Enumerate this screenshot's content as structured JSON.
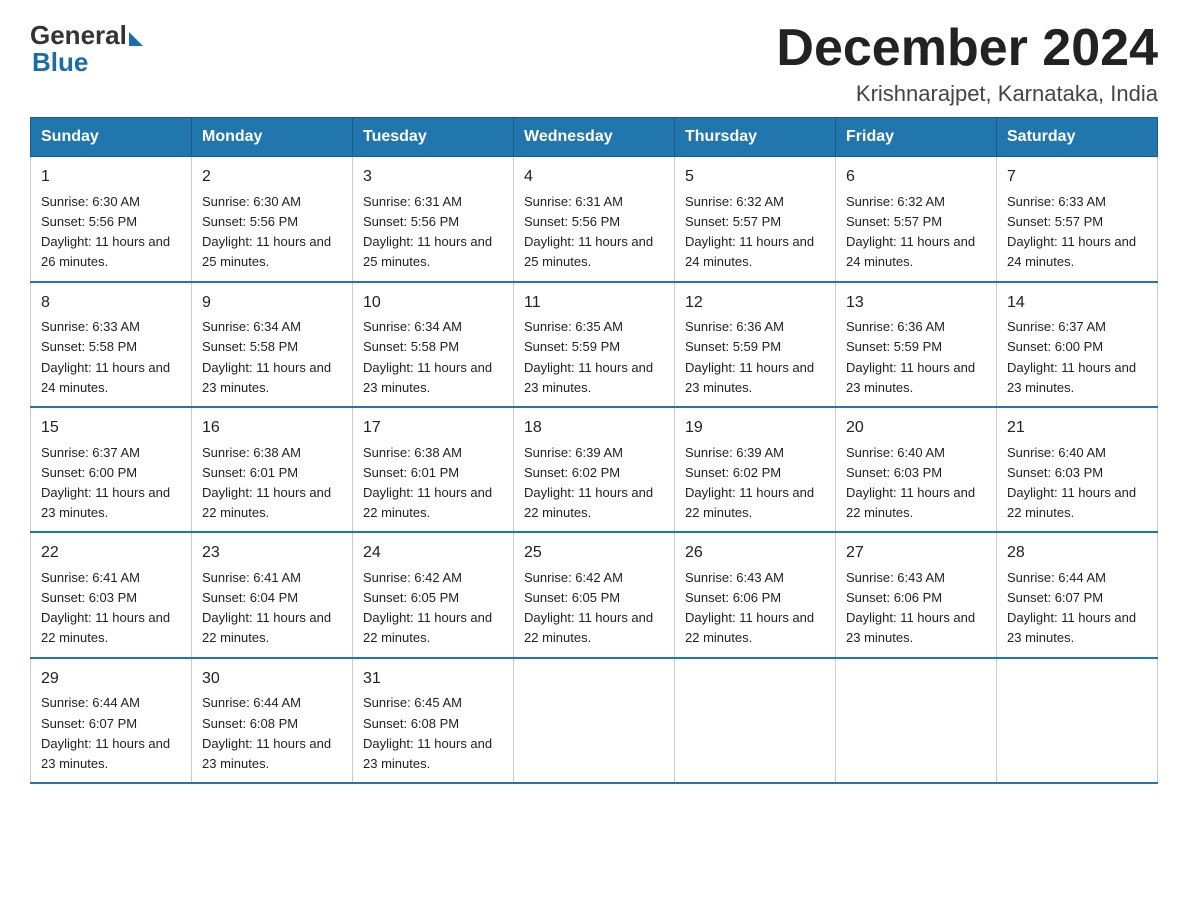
{
  "logo": {
    "general": "General",
    "blue": "Blue"
  },
  "header": {
    "title": "December 2024",
    "location": "Krishnarajpet, Karnataka, India"
  },
  "weekdays": [
    "Sunday",
    "Monday",
    "Tuesday",
    "Wednesday",
    "Thursday",
    "Friday",
    "Saturday"
  ],
  "weeks": [
    [
      {
        "day": "1",
        "sunrise": "6:30 AM",
        "sunset": "5:56 PM",
        "daylight": "11 hours and 26 minutes."
      },
      {
        "day": "2",
        "sunrise": "6:30 AM",
        "sunset": "5:56 PM",
        "daylight": "11 hours and 25 minutes."
      },
      {
        "day": "3",
        "sunrise": "6:31 AM",
        "sunset": "5:56 PM",
        "daylight": "11 hours and 25 minutes."
      },
      {
        "day": "4",
        "sunrise": "6:31 AM",
        "sunset": "5:56 PM",
        "daylight": "11 hours and 25 minutes."
      },
      {
        "day": "5",
        "sunrise": "6:32 AM",
        "sunset": "5:57 PM",
        "daylight": "11 hours and 24 minutes."
      },
      {
        "day": "6",
        "sunrise": "6:32 AM",
        "sunset": "5:57 PM",
        "daylight": "11 hours and 24 minutes."
      },
      {
        "day": "7",
        "sunrise": "6:33 AM",
        "sunset": "5:57 PM",
        "daylight": "11 hours and 24 minutes."
      }
    ],
    [
      {
        "day": "8",
        "sunrise": "6:33 AM",
        "sunset": "5:58 PM",
        "daylight": "11 hours and 24 minutes."
      },
      {
        "day": "9",
        "sunrise": "6:34 AM",
        "sunset": "5:58 PM",
        "daylight": "11 hours and 23 minutes."
      },
      {
        "day": "10",
        "sunrise": "6:34 AM",
        "sunset": "5:58 PM",
        "daylight": "11 hours and 23 minutes."
      },
      {
        "day": "11",
        "sunrise": "6:35 AM",
        "sunset": "5:59 PM",
        "daylight": "11 hours and 23 minutes."
      },
      {
        "day": "12",
        "sunrise": "6:36 AM",
        "sunset": "5:59 PM",
        "daylight": "11 hours and 23 minutes."
      },
      {
        "day": "13",
        "sunrise": "6:36 AM",
        "sunset": "5:59 PM",
        "daylight": "11 hours and 23 minutes."
      },
      {
        "day": "14",
        "sunrise": "6:37 AM",
        "sunset": "6:00 PM",
        "daylight": "11 hours and 23 minutes."
      }
    ],
    [
      {
        "day": "15",
        "sunrise": "6:37 AM",
        "sunset": "6:00 PM",
        "daylight": "11 hours and 23 minutes."
      },
      {
        "day": "16",
        "sunrise": "6:38 AM",
        "sunset": "6:01 PM",
        "daylight": "11 hours and 22 minutes."
      },
      {
        "day": "17",
        "sunrise": "6:38 AM",
        "sunset": "6:01 PM",
        "daylight": "11 hours and 22 minutes."
      },
      {
        "day": "18",
        "sunrise": "6:39 AM",
        "sunset": "6:02 PM",
        "daylight": "11 hours and 22 minutes."
      },
      {
        "day": "19",
        "sunrise": "6:39 AM",
        "sunset": "6:02 PM",
        "daylight": "11 hours and 22 minutes."
      },
      {
        "day": "20",
        "sunrise": "6:40 AM",
        "sunset": "6:03 PM",
        "daylight": "11 hours and 22 minutes."
      },
      {
        "day": "21",
        "sunrise": "6:40 AM",
        "sunset": "6:03 PM",
        "daylight": "11 hours and 22 minutes."
      }
    ],
    [
      {
        "day": "22",
        "sunrise": "6:41 AM",
        "sunset": "6:03 PM",
        "daylight": "11 hours and 22 minutes."
      },
      {
        "day": "23",
        "sunrise": "6:41 AM",
        "sunset": "6:04 PM",
        "daylight": "11 hours and 22 minutes."
      },
      {
        "day": "24",
        "sunrise": "6:42 AM",
        "sunset": "6:05 PM",
        "daylight": "11 hours and 22 minutes."
      },
      {
        "day": "25",
        "sunrise": "6:42 AM",
        "sunset": "6:05 PM",
        "daylight": "11 hours and 22 minutes."
      },
      {
        "day": "26",
        "sunrise": "6:43 AM",
        "sunset": "6:06 PM",
        "daylight": "11 hours and 22 minutes."
      },
      {
        "day": "27",
        "sunrise": "6:43 AM",
        "sunset": "6:06 PM",
        "daylight": "11 hours and 23 minutes."
      },
      {
        "day": "28",
        "sunrise": "6:44 AM",
        "sunset": "6:07 PM",
        "daylight": "11 hours and 23 minutes."
      }
    ],
    [
      {
        "day": "29",
        "sunrise": "6:44 AM",
        "sunset": "6:07 PM",
        "daylight": "11 hours and 23 minutes."
      },
      {
        "day": "30",
        "sunrise": "6:44 AM",
        "sunset": "6:08 PM",
        "daylight": "11 hours and 23 minutes."
      },
      {
        "day": "31",
        "sunrise": "6:45 AM",
        "sunset": "6:08 PM",
        "daylight": "11 hours and 23 minutes."
      },
      null,
      null,
      null,
      null
    ]
  ]
}
